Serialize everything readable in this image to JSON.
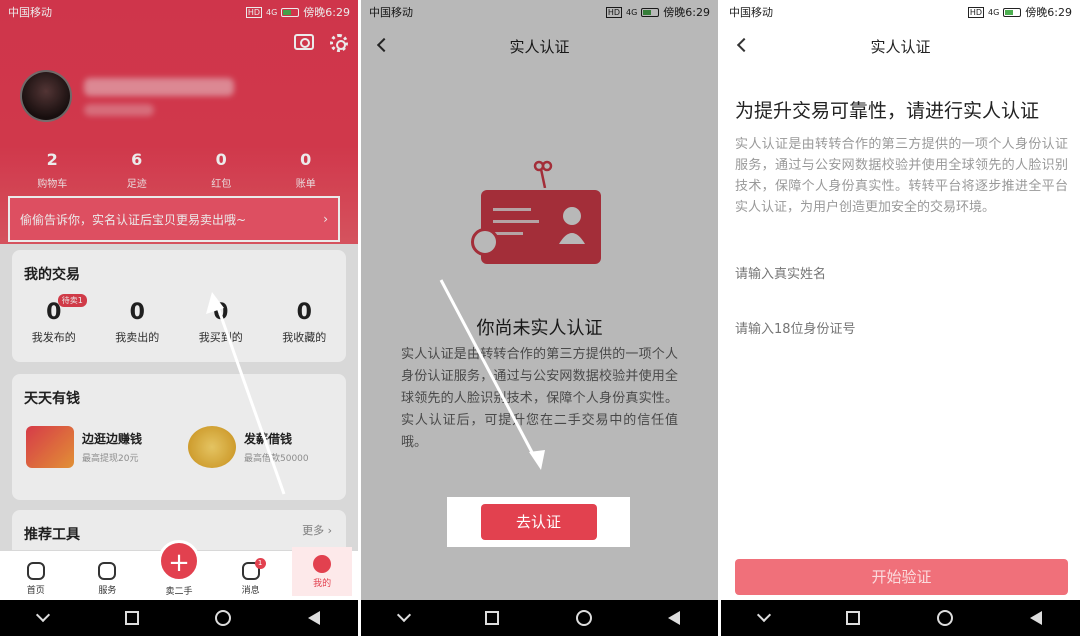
{
  "status": {
    "carrier": "中国移动",
    "time": "傍晚6:29",
    "signal": "4G",
    "hd": "HD"
  },
  "panel1": {
    "stats": [
      {
        "num": "2",
        "label": "购物车"
      },
      {
        "num": "6",
        "label": "足迹"
      },
      {
        "num": "0",
        "label": "红包"
      },
      {
        "num": "0",
        "label": "账单"
      }
    ],
    "banner": "偷偷告诉你，实名认证后宝贝更易卖出哦~",
    "banner_chevron": "›",
    "trade_title": "我的交易",
    "trade_badge": "待卖1",
    "trades": [
      {
        "num": "0",
        "label": "我发布的"
      },
      {
        "num": "0",
        "label": "我卖出的"
      },
      {
        "num": "0",
        "label": "我买到的"
      },
      {
        "num": "0",
        "label": "我收藏的"
      }
    ],
    "money_title": "天天有钱",
    "money_items": [
      {
        "title": "边逛边赚钱",
        "sub": "最高提现20元"
      },
      {
        "title": "发薪借钱",
        "sub": "最高借款50000"
      }
    ],
    "tools_title": "推荐工具",
    "tools_more": "更多 ›",
    "tabs": [
      {
        "label": "首页"
      },
      {
        "label": "服务"
      },
      {
        "label": "卖二手"
      },
      {
        "label": "消息",
        "badge": "1"
      },
      {
        "label": "我的"
      }
    ],
    "sell_plus": "+"
  },
  "panel2": {
    "title": "实人认证",
    "heading": "你尚未实人认证",
    "desc": "实人认证是由转转合作的第三方提供的一项个人身份认证服务，通过与公安网数据校验并使用全球领先的人脸识别技术，保障个人身份真实性。实人认证后，可提升您在二手交易中的信任值哦。",
    "button": "去认证"
  },
  "panel3": {
    "title": "实人认证",
    "heading": "为提升交易可靠性，请进行实人认证",
    "desc": "实人认证是由转转合作的第三方提供的一项个人身份认证服务，通过与公安网数据校验并使用全球领先的人脸识别技术，保障个人身份真实性。转转平台将逐步推进全平台实人认证，为用户创造更加安全的交易环境。",
    "name_placeholder": "请输入真实姓名",
    "id_placeholder": "请输入18位身份证号",
    "button": "开始验证"
  }
}
